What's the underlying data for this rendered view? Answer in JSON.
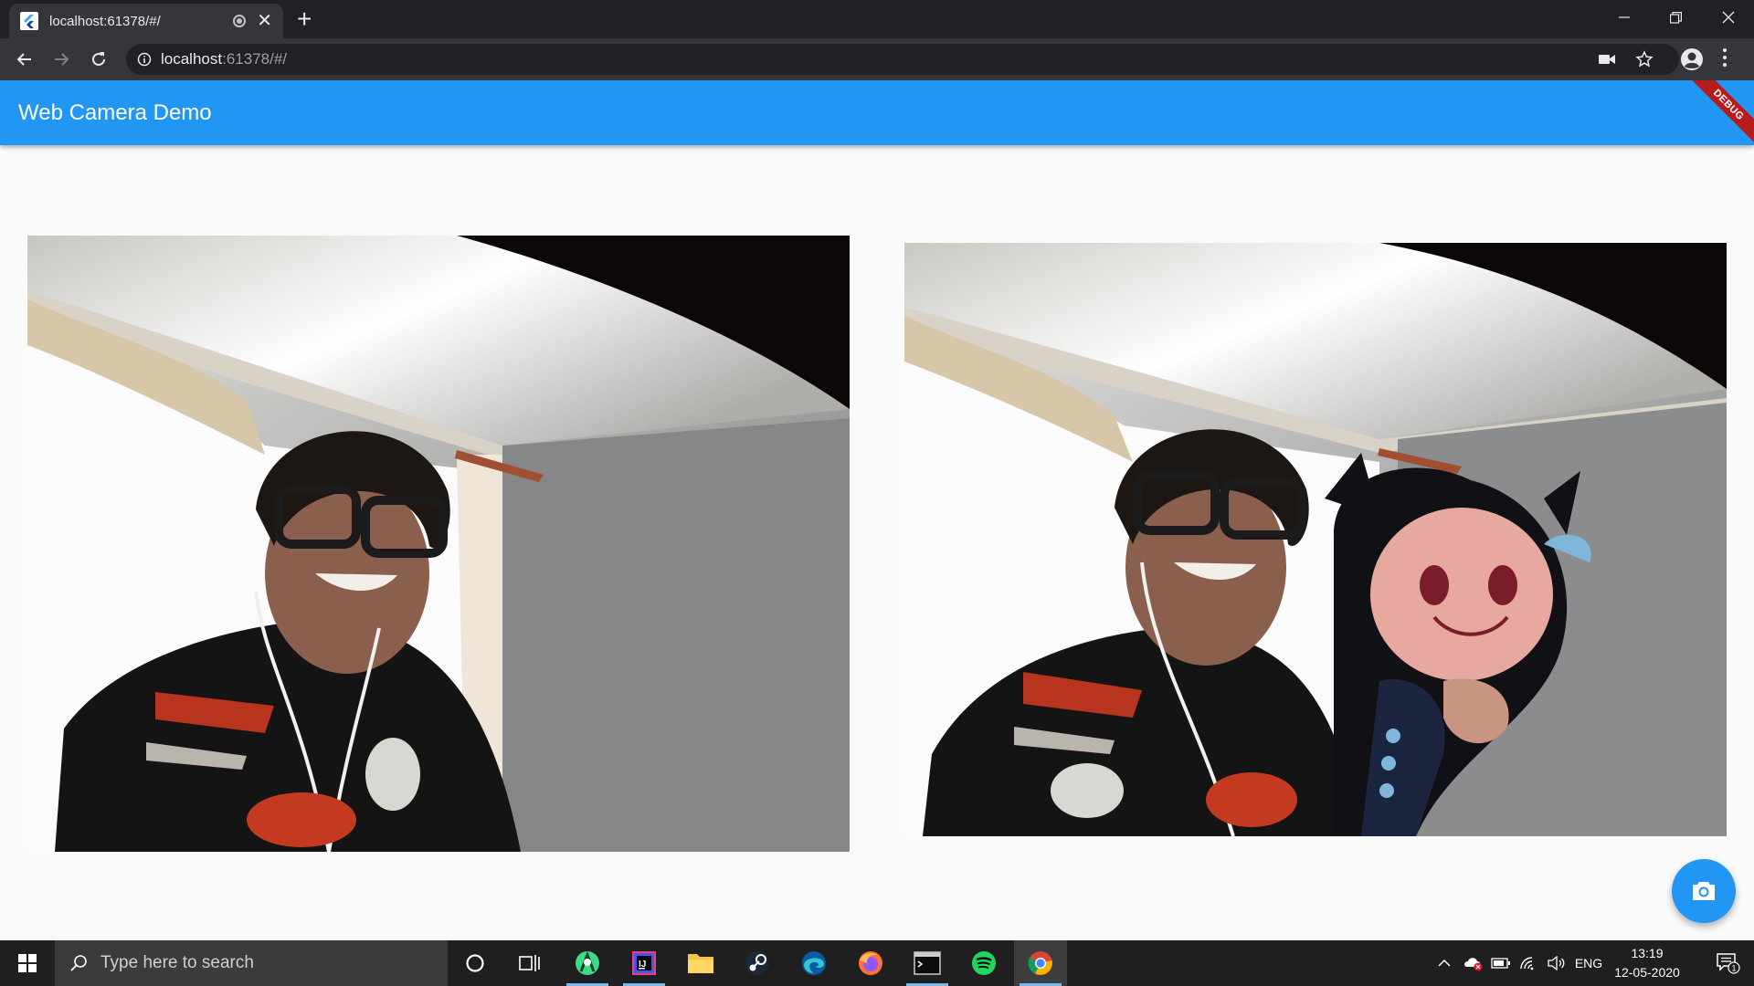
{
  "browser": {
    "tab": {
      "title": "localhost:61378/#/",
      "favicon": "flutter-icon"
    },
    "url_host": "localhost",
    "url_rest": ":61378/#/",
    "colors": {
      "frame": "#202124",
      "toolbar": "#35363a"
    }
  },
  "app": {
    "title": "Web Camera Demo",
    "debug_banner": "DEBUG",
    "primary_color": "#2196f3",
    "background": "#fafafa",
    "camera_views": [
      {
        "name": "live-camera-preview"
      },
      {
        "name": "captured-snapshot"
      }
    ],
    "fab": {
      "icon": "camera-icon"
    }
  },
  "taskbar": {
    "search_placeholder": "Type here to search",
    "apps": [
      "cortana-icon",
      "task-view-icon",
      "android-studio-icon",
      "intellij-icon",
      "file-explorer-icon",
      "steam-icon",
      "edge-icon",
      "firefox-icon",
      "terminal-icon",
      "spotify-icon",
      "chrome-icon"
    ],
    "language": "ENG",
    "time": "13:19",
    "date": "12-05-2020",
    "notification_count": "1"
  }
}
